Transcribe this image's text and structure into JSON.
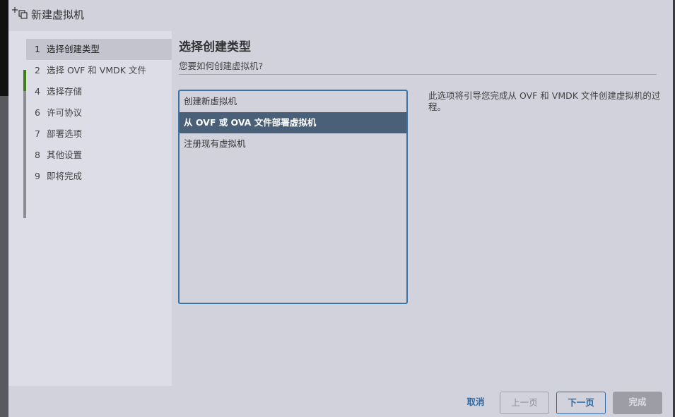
{
  "window": {
    "title": "新建虚拟机",
    "icon": "new-vm-icon"
  },
  "steps": [
    {
      "num": "1",
      "label": "选择创建类型",
      "active": true
    },
    {
      "num": "2",
      "label": "选择 OVF 和 VMDK 文件",
      "active": false
    },
    {
      "num": "4",
      "label": "选择存储",
      "active": false
    },
    {
      "num": "6",
      "label": "许可协议",
      "active": false
    },
    {
      "num": "7",
      "label": "部署选项",
      "active": false
    },
    {
      "num": "8",
      "label": "其他设置",
      "active": false
    },
    {
      "num": "9",
      "label": "即将完成",
      "active": false
    }
  ],
  "main": {
    "title": "选择创建类型",
    "subtitle": "您要如何创建虚拟机?",
    "options": [
      {
        "label": "创建新虚拟机",
        "selected": false
      },
      {
        "label": "从 OVF 或 OVA 文件部署虚拟机",
        "selected": true
      },
      {
        "label": "注册现有虚拟机",
        "selected": false
      }
    ],
    "description": "此选项将引导您完成从 OVF 和 VMDK 文件创建虚拟机的过程。"
  },
  "footer": {
    "cancel": "取消",
    "prev": "上一页",
    "next": "下一页",
    "finish": "完成"
  },
  "colors": {
    "accent": "#2f6aa5",
    "active_step": "#3f7d18",
    "selected_row": "#4a5f78",
    "dialog_bg": "#d1d2dc"
  }
}
